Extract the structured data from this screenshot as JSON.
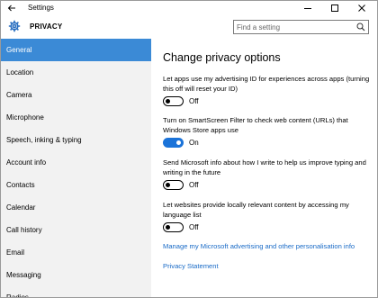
{
  "window": {
    "title": "Settings"
  },
  "header": {
    "section_title": "PRIVACY",
    "search_placeholder": "Find a setting"
  },
  "sidebar": {
    "items": [
      {
        "label": "General",
        "active": true
      },
      {
        "label": "Location"
      },
      {
        "label": "Camera"
      },
      {
        "label": "Microphone"
      },
      {
        "label": "Speech, inking & typing"
      },
      {
        "label": "Account info"
      },
      {
        "label": "Contacts"
      },
      {
        "label": "Calendar"
      },
      {
        "label": "Call history"
      },
      {
        "label": "Email"
      },
      {
        "label": "Messaging"
      },
      {
        "label": "Radios"
      }
    ]
  },
  "main": {
    "title": "Change privacy options",
    "options": [
      {
        "label": "Let apps use my advertising ID for experiences across apps (turning this off will reset your ID)",
        "state": "Off"
      },
      {
        "label": "Turn on SmartScreen Filter to check web content (URLs) that Windows Store apps use",
        "state": "On"
      },
      {
        "label": "Send Microsoft info about how I write to help us improve typing and writing in the future",
        "state": "Off"
      },
      {
        "label": "Let websites provide locally relevant content by accessing my language list",
        "state": "Off"
      }
    ],
    "links": {
      "manage": "Manage my Microsoft advertising and other personalisation info",
      "privacy": "Privacy Statement"
    }
  },
  "colors": {
    "accent": "#3b8ad6",
    "toggle_on": "#1a73d9",
    "link": "#1a6bc7",
    "sidebar_bg": "#f2f2f2"
  }
}
